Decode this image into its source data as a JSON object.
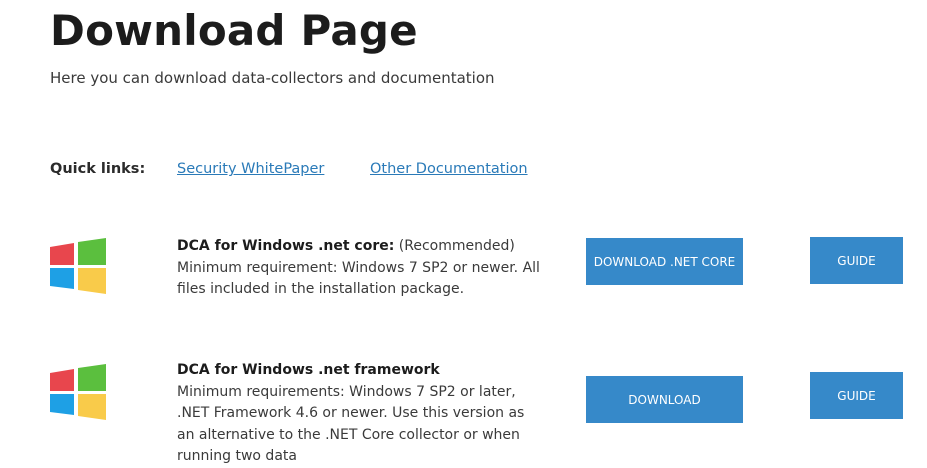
{
  "header": {
    "title": "Download Page",
    "subtitle": "Here you can download data-collectors and documentation"
  },
  "quick_links": {
    "label": "Quick links:",
    "links": [
      "Security WhitePaper",
      "Other Documentation"
    ]
  },
  "products": [
    {
      "title": "DCA for Windows .net core:",
      "tag": "(Recommended)",
      "description": "Minimum requirement: Windows 7 SP2 or newer. All files included in the installation package.",
      "download_label": "DOWNLOAD .NET CORE",
      "guide_label": "GUIDE",
      "icon": "windows-logo-icon"
    },
    {
      "title": "DCA for Windows .net framework",
      "tag": "",
      "description": "Minimum requirements: Windows 7 SP2 or later, .NET Framework 4.6 or newer. Use this version as an alternative to the .NET Core collector or when running two data",
      "download_label": "DOWNLOAD",
      "guide_label": "GUIDE",
      "icon": "windows-logo-icon"
    }
  ],
  "colors": {
    "button_bg": "#3689c9",
    "link": "#2a7ab8",
    "logo_red": "#e8464d",
    "logo_green": "#5bbf3e",
    "logo_blue": "#1ea0e5",
    "logo_yellow": "#f9cb4a"
  }
}
